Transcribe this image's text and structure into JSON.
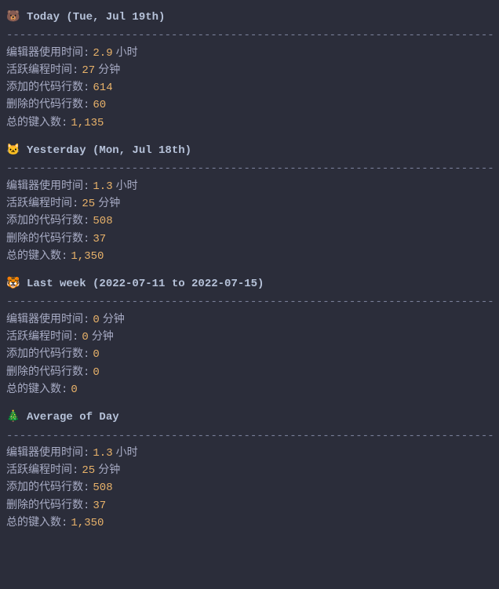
{
  "divider": "---------------------------------------------------------------------------",
  "labels": {
    "editor_time": "编辑器使用时间",
    "active_coding": "活跃编程时间",
    "lines_added": "添加的代码行数",
    "lines_deleted": "删除的代码行数",
    "keystrokes": "总的键入数"
  },
  "sections": [
    {
      "icon": "🐻",
      "title": "Today (Tue, Jul 19th)",
      "stats": {
        "editor_time": {
          "value": "2.9",
          "unit": "小时"
        },
        "active_coding": {
          "value": "27",
          "unit": "分钟"
        },
        "lines_added": {
          "value": "614",
          "unit": ""
        },
        "lines_deleted": {
          "value": "60",
          "unit": ""
        },
        "keystrokes": {
          "value": "1,135",
          "unit": ""
        }
      }
    },
    {
      "icon": "🐱",
      "title": "Yesterday (Mon, Jul 18th)",
      "stats": {
        "editor_time": {
          "value": "1.3",
          "unit": "小时"
        },
        "active_coding": {
          "value": "25",
          "unit": "分钟"
        },
        "lines_added": {
          "value": "508",
          "unit": ""
        },
        "lines_deleted": {
          "value": "37",
          "unit": ""
        },
        "keystrokes": {
          "value": "1,350",
          "unit": ""
        }
      }
    },
    {
      "icon": "🐯",
      "title": "Last week (2022-07-11 to 2022-07-15)",
      "stats": {
        "editor_time": {
          "value": "0",
          "unit": "分钟"
        },
        "active_coding": {
          "value": "0",
          "unit": "分钟"
        },
        "lines_added": {
          "value": "0",
          "unit": ""
        },
        "lines_deleted": {
          "value": "0",
          "unit": ""
        },
        "keystrokes": {
          "value": "0",
          "unit": ""
        }
      }
    },
    {
      "icon": "🎄",
      "title": "Average of Day",
      "stats": {
        "editor_time": {
          "value": "1.3",
          "unit": "小时"
        },
        "active_coding": {
          "value": "25",
          "unit": "分钟"
        },
        "lines_added": {
          "value": "508",
          "unit": ""
        },
        "lines_deleted": {
          "value": "37",
          "unit": ""
        },
        "keystrokes": {
          "value": "1,350",
          "unit": ""
        }
      }
    }
  ]
}
